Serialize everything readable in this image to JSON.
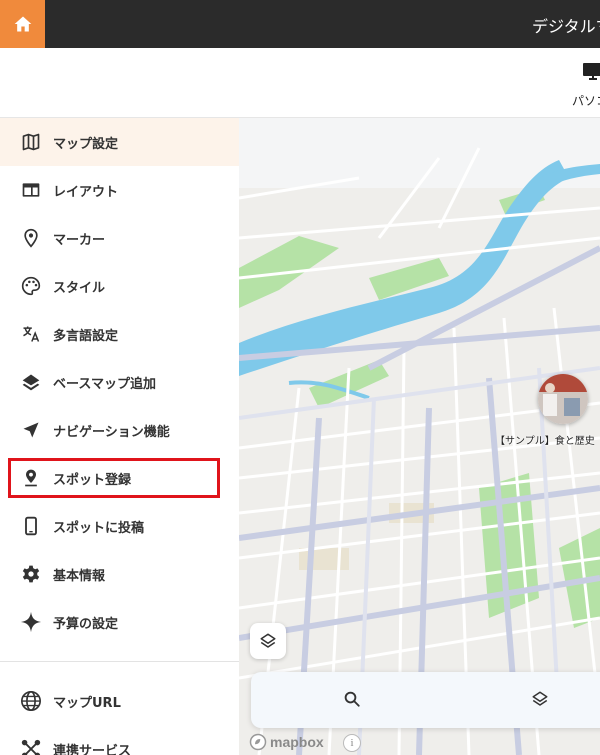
{
  "app": {
    "title": "デジタルマ"
  },
  "header": {
    "device_label": "パソコ"
  },
  "sidebar": {
    "items": [
      {
        "id": "map-settings",
        "label": "マップ設定",
        "icon": "map-icon",
        "active": true
      },
      {
        "id": "layout",
        "label": "レイアウト",
        "icon": "layout-icon"
      },
      {
        "id": "marker",
        "label": "マーカー",
        "icon": "marker-icon"
      },
      {
        "id": "style",
        "label": "スタイル",
        "icon": "palette-icon"
      },
      {
        "id": "multilingual",
        "label": "多言語設定",
        "icon": "translate-icon"
      },
      {
        "id": "add-basemap",
        "label": "ベースマップ追加",
        "icon": "layers-icon"
      },
      {
        "id": "navigation",
        "label": "ナビゲーション機能",
        "icon": "navigation-icon"
      },
      {
        "id": "spot-registration",
        "label": "スポット登録",
        "icon": "spot-pin-icon",
        "highlighted": true
      },
      {
        "id": "post-to-spot",
        "label": "スポットに投稿",
        "icon": "smartphone-icon"
      },
      {
        "id": "basic-info",
        "label": "基本情報",
        "icon": "gear-icon"
      },
      {
        "id": "budget",
        "label": "予算の設定",
        "icon": "sparkle-icon"
      }
    ],
    "bottom_items": [
      {
        "id": "map-url",
        "label": "マップURL",
        "icon": "globe-icon"
      },
      {
        "id": "linked-services",
        "label": "連携サービス",
        "icon": "connections-icon"
      }
    ]
  },
  "map": {
    "spot_label": "【サンプル】食と歴史",
    "attribution": "mapbox",
    "info": "i"
  },
  "colors": {
    "accent": "#f08a3c",
    "topbar": "#2b2b2b",
    "highlight": "#e0141b",
    "active_bg": "#fdf3ea",
    "river": "#7ec8ea",
    "park": "#a8dc9a"
  }
}
